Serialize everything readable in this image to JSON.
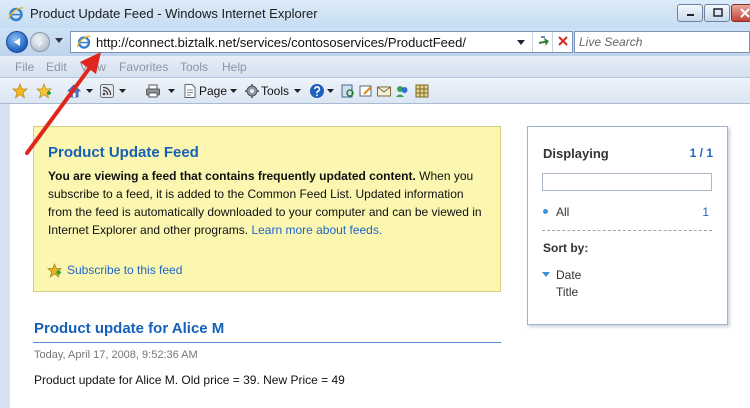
{
  "window": {
    "title": "Product Update Feed - Windows Internet Explorer"
  },
  "address_bar": {
    "url": "http://connect.biztalk.net/services/contososervices/ProductFeed/",
    "search_placeholder": "Live Search"
  },
  "menu": {
    "items": [
      "File",
      "Edit",
      "View",
      "Favorites",
      "Tools",
      "Help"
    ]
  },
  "command_bar": {
    "page_label": "Page",
    "tools_label": "Tools"
  },
  "feed_notice": {
    "title": "Product Update Feed",
    "bold_text": "You are viewing a feed that contains frequently updated content.",
    "text": " When you subscribe to a feed, it is added to the Common Feed List. Updated information from the feed is automatically downloaded to your computer and can be viewed in Internet Explorer and other programs. ",
    "learn_more": "Learn more about feeds.",
    "subscribe": "Subscribe to this feed"
  },
  "feed_item": {
    "title": "Product update for Alice M",
    "date": "Today, April 17, 2008, 9:52:36 AM",
    "body": "Product update for Alice M. Old price = 39. New Price = 49"
  },
  "sidebar": {
    "displaying_label": "Displaying",
    "displaying_count": "1 / 1",
    "all_label": "All",
    "all_count": "1",
    "sort_by_label": "Sort by:",
    "sort_options": [
      "Date",
      "Title"
    ]
  },
  "colors": {
    "accent_blue": "#1560b8",
    "link_blue": "#1f65c8",
    "notice_yellow": "#fbf6b0",
    "annotation_red": "#e0261c"
  }
}
